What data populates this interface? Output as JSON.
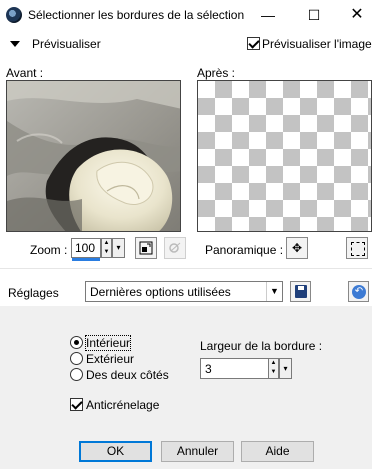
{
  "window": {
    "title": "Sélectionner les bordures de la sélection",
    "minimize_glyph": "—",
    "maximize_glyph": "☐",
    "close_glyph": "✕"
  },
  "preview_toggle": {
    "label": "Prévisualiser",
    "checkbox_label": "Prévisualiser l'image",
    "checked": true
  },
  "preview": {
    "before_label": "Avant :",
    "after_label": "Après :"
  },
  "zoom": {
    "label": "Zoom :",
    "value": "100",
    "pan_label": "Panoramique :",
    "pan_icon": "✥"
  },
  "settings": {
    "label": "Réglages",
    "preset_value": "Dernières options utilisées"
  },
  "options": {
    "radio_interior": "Intérieur",
    "radio_exterior": "Extérieur",
    "radio_both": "Des deux côtés",
    "selected": "interior",
    "border_width_label": "Largeur de la bordure :",
    "border_width_value": "3",
    "antialias_label": "Anticrénelage",
    "antialias_checked": true
  },
  "buttons": {
    "ok": "OK",
    "cancel": "Annuler",
    "help": "Aide"
  },
  "colors": {
    "accent": "#0078d7",
    "checker": "#c3c3c3"
  }
}
